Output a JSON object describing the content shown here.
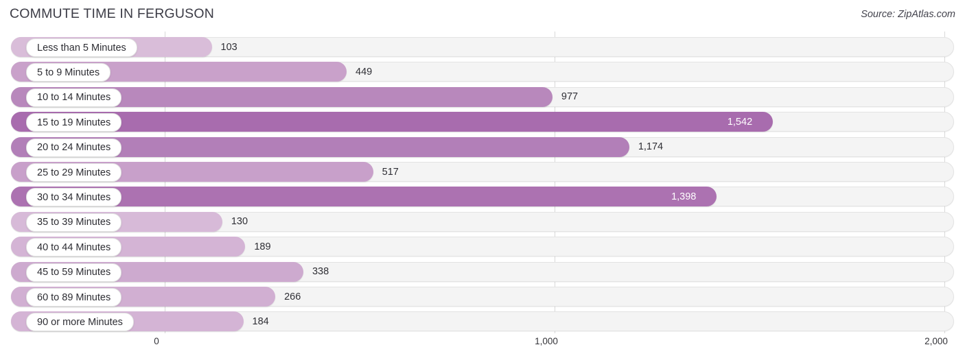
{
  "header": {
    "title": "COMMUTE TIME IN FERGUSON",
    "source": "Source: ZipAtlas.com"
  },
  "chart_data": {
    "type": "bar",
    "orientation": "horizontal",
    "title": "COMMUTE TIME IN FERGUSON",
    "subtitle": "Source: ZipAtlas.com",
    "xlabel": "",
    "ylabel": "",
    "xlim": [
      0,
      2000
    ],
    "grid": true,
    "legend": "none",
    "xticks": [
      0,
      1000,
      2000
    ],
    "xtick_labels": [
      "0",
      "1,000",
      "2,000"
    ],
    "categories": [
      "Less than 5 Minutes",
      "5 to 9 Minutes",
      "10 to 14 Minutes",
      "15 to 19 Minutes",
      "20 to 24 Minutes",
      "25 to 29 Minutes",
      "30 to 34 Minutes",
      "35 to 39 Minutes",
      "40 to 44 Minutes",
      "45 to 59 Minutes",
      "60 to 89 Minutes",
      "90 or more Minutes"
    ],
    "values": [
      103,
      449,
      977,
      1542,
      1174,
      517,
      1398,
      130,
      189,
      338,
      266,
      184
    ],
    "value_labels": [
      "103",
      "449",
      "977",
      "1,542",
      "1,174",
      "517",
      "1,398",
      "130",
      "189",
      "338",
      "266",
      "184"
    ]
  },
  "bars": [
    {
      "label": "Less than 5 Minutes",
      "value": 103,
      "value_label": "103",
      "color": "#d9bdd9",
      "label_inside": false
    },
    {
      "label": "5 to 9 Minutes",
      "value": 449,
      "value_label": "449",
      "color": "#c9a1ca",
      "label_inside": false
    },
    {
      "label": "10 to 14 Minutes",
      "value": 977,
      "value_label": "977",
      "color": "#b888bc",
      "label_inside": false
    },
    {
      "label": "15 to 19 Minutes",
      "value": 1542,
      "value_label": "1,542",
      "color": "#a86cae",
      "label_inside": true
    },
    {
      "label": "20 to 24 Minutes",
      "value": 1174,
      "value_label": "1,174",
      "color": "#b27fb8",
      "label_inside": false
    },
    {
      "label": "25 to 29 Minutes",
      "value": 517,
      "value_label": "517",
      "color": "#c8a0ca",
      "label_inside": false
    },
    {
      "label": "30 to 34 Minutes",
      "value": 1398,
      "value_label": "1,398",
      "color": "#ac72b1",
      "label_inside": true
    },
    {
      "label": "35 to 39 Minutes",
      "value": 130,
      "value_label": "130",
      "color": "#d7bad8",
      "label_inside": false
    },
    {
      "label": "40 to 44 Minutes",
      "value": 189,
      "value_label": "189",
      "color": "#d4b4d5",
      "label_inside": false
    },
    {
      "label": "45 to 59 Minutes",
      "value": 338,
      "value_label": "338",
      "color": "#cdaacf",
      "label_inside": false
    },
    {
      "label": "60 to 89 Minutes",
      "value": 266,
      "value_label": "266",
      "color": "#d1afd2",
      "label_inside": false
    },
    {
      "label": "90 or more Minutes",
      "value": 184,
      "value_label": "184",
      "color": "#d4b4d5",
      "label_inside": false
    }
  ],
  "axis": {
    "ticks": [
      {
        "label": "0",
        "value": 0
      },
      {
        "label": "1,000",
        "value": 1000
      },
      {
        "label": "2,000",
        "value": 2000
      }
    ]
  },
  "colors": {
    "track": "#f4f4f4",
    "track_border": "#e3e3e3",
    "gridline": "#d8d8d8",
    "title_text": "#3c3c46",
    "value_text": "#2f2f35"
  }
}
